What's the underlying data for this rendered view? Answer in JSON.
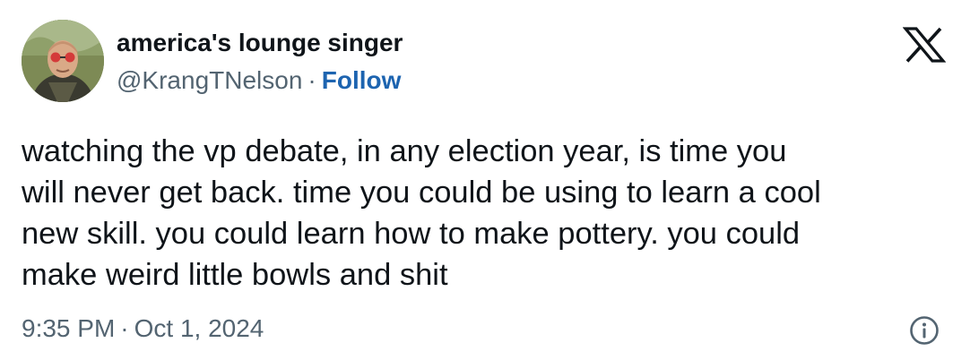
{
  "author": {
    "display_name": "america's lounge singer",
    "handle": "@KrangTNelson",
    "separator": "·",
    "follow_label": "Follow",
    "avatar_icon": "profile-photo"
  },
  "brand": {
    "logo_icon": "x-logo-icon"
  },
  "tweet": {
    "text": "watching the vp debate, in any election year, is time you\nwill never get back. time you could be using to learn a cool\nnew skill. you could learn how to make pottery. you could\nmake weird little bowls and shit"
  },
  "meta": {
    "time": "9:35 PM",
    "separator": "·",
    "date": "Oct 1, 2024",
    "info_icon": "info-icon"
  },
  "colors": {
    "text": "#0f1419",
    "secondary": "#536471",
    "link": "#1d64b0",
    "background": "#ffffff"
  }
}
